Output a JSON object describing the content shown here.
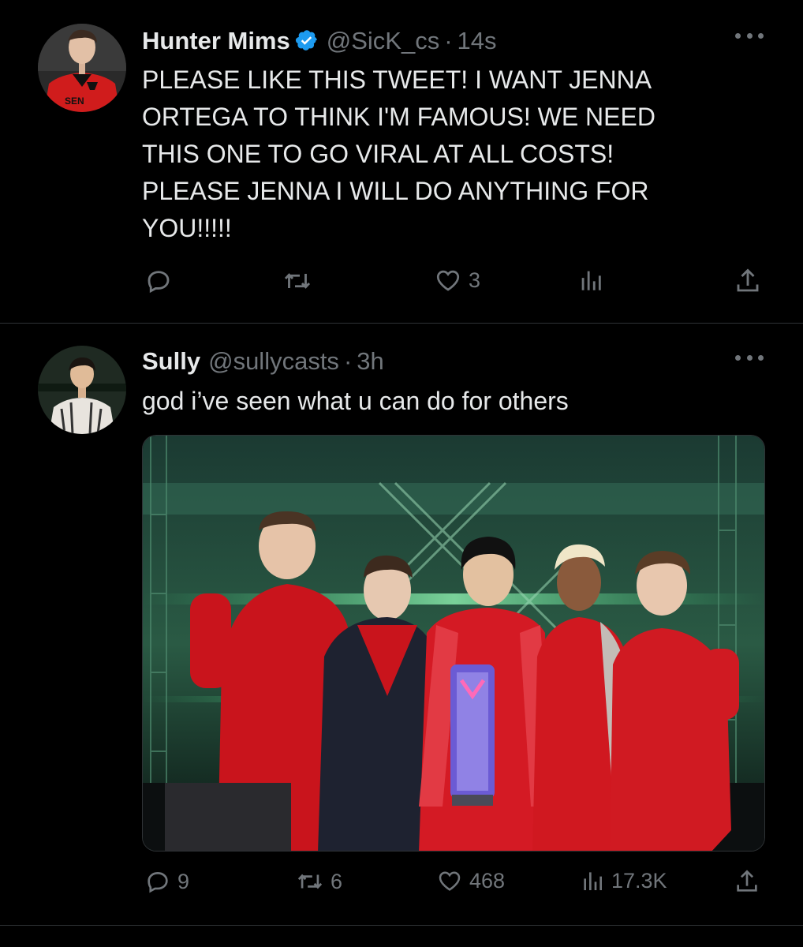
{
  "tweets": [
    {
      "name": "Hunter Mims",
      "handle": "@SicK_cs",
      "dot": "·",
      "time": "14s",
      "verified": true,
      "text_lines": [
        "PLEASE LIKE THIS TWEET! I WANT JENNA",
        "ORTEGA TO THINK I'M FAMOUS! WE NEED",
        "THIS ONE TO GO VIRAL AT ALL COSTS!",
        "PLEASE JENNA I WILL DO ANYTHING FOR",
        "YOU!!!!!"
      ],
      "avatar_logo": "SEN",
      "stats": {
        "replies": "",
        "retweets": "",
        "likes": "3",
        "views": ""
      }
    },
    {
      "name": "Sully",
      "handle": "@sullycasts",
      "dot": "·",
      "time": "3h",
      "verified": false,
      "text_lines": [
        "god i’ve seen what u can do for others"
      ],
      "stats": {
        "replies": "9",
        "retweets": "6",
        "likes": "468",
        "views": "17.3K"
      }
    }
  ],
  "icons": [
    "reply-icon",
    "retweet-icon",
    "like-icon",
    "views-icon",
    "share-icon",
    "more-icon",
    "verified-badge-icon"
  ],
  "colors": {
    "background": "#000000",
    "text": "#e7e9ea",
    "secondary": "#71767b",
    "divider": "#2f3336",
    "verified": "#1d9bf0",
    "team_red": "#c8102e"
  }
}
